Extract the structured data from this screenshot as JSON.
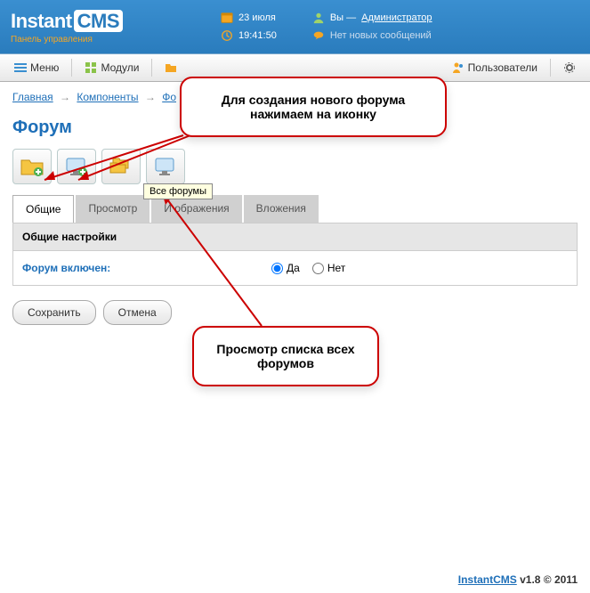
{
  "header": {
    "logo_prefix": "Instant",
    "logo_suffix": "CMS",
    "logo_sub": "Панель управления",
    "date": "23 июля",
    "time": "19:41:50",
    "user_prefix": "Вы —",
    "user_name": "Администратор",
    "messages": "Нет новых сообщений"
  },
  "nav": {
    "menu": "Меню",
    "modules": "Модули",
    "users": "Пользователи"
  },
  "breadcrumb": {
    "home": "Главная",
    "components": "Компоненты",
    "last": "Фо"
  },
  "page_title": "Форум",
  "tooltip": "Все форумы",
  "tabs": {
    "general": "Общие",
    "view": "Просмотр",
    "images": "И ображения",
    "attachments": "Вложения"
  },
  "settings": {
    "section_title": "Общие настройки",
    "forum_enabled_label": "Форум включен:",
    "yes": "Да",
    "no": "Нет"
  },
  "buttons": {
    "save": "Сохранить",
    "cancel": "Отмена"
  },
  "callouts": {
    "top_line1": "Для создания нового форума",
    "top_line2": "нажимаем на иконку",
    "bottom_line1": "Просмотр списка всех",
    "bottom_line2": "форумов"
  },
  "footer": {
    "brand": "InstantCMS",
    "version": "v1.8 © 2011"
  }
}
